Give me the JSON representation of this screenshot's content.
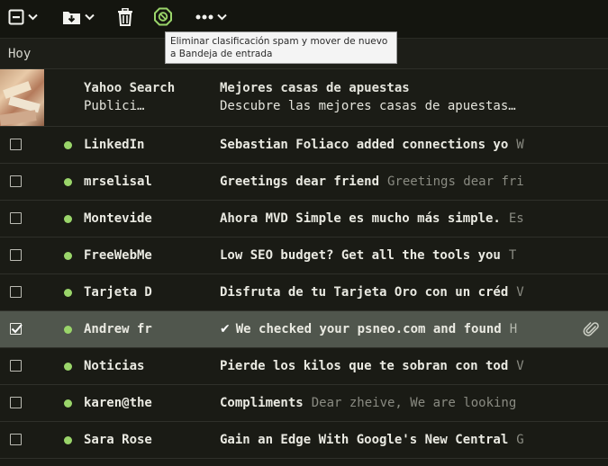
{
  "toolbar": {
    "icons": [
      "select-checkbox-icon",
      "chevron-down-icon",
      "move-to-folder-icon",
      "chevron-down-icon",
      "trash-icon",
      "not-spam-icon",
      "more-icon",
      "chevron-down-icon"
    ],
    "accent_color": "#9ad56a"
  },
  "tooltip": {
    "text": "Eliminar clasificación spam y mover de nuevo a Bandeja de entrada"
  },
  "section": {
    "title": "Hoy"
  },
  "ad": {
    "sender": "Yahoo Search",
    "sender_sub": "Publici…",
    "subject": "Mejores casas de apuestas",
    "body": "Descubre las mejores casas de apuestas…"
  },
  "messages": [
    {
      "sender": "LinkedIn",
      "subject": "Sebastian Foliaco added connections yo",
      "preview": "W",
      "checked": false,
      "attachment": false
    },
    {
      "sender": "mrselisal",
      "subject": "Greetings dear friend",
      "preview": "Greetings dear fri",
      "checked": false,
      "attachment": false
    },
    {
      "sender": "Montevide",
      "subject": "Ahora MVD Simple es mucho más simple.",
      "preview": "Es",
      "checked": false,
      "attachment": false
    },
    {
      "sender": "FreeWebMe",
      "subject": "Low SEO budget? Get all the tools you",
      "preview": "T",
      "checked": false,
      "attachment": false
    },
    {
      "sender": "Tarjeta D",
      "subject": "Disfruta de tu Tarjeta Oro con un créd",
      "preview": "V",
      "checked": false,
      "attachment": false
    },
    {
      "sender": "Andrew fr",
      "subject": "We checked your psneo.com and found",
      "preview": "H",
      "checked": true,
      "attachment": true
    },
    {
      "sender": "Noticias",
      "subject": "Pierde los kilos que te sobran con tod",
      "preview": "V",
      "checked": false,
      "attachment": false
    },
    {
      "sender": "karen@the",
      "subject": "Compliments",
      "preview": "Dear zheive, We are looking",
      "checked": false,
      "attachment": false
    },
    {
      "sender": "Sara Rose",
      "subject": "Gain an Edge With Google's New Central",
      "preview": "G",
      "checked": false,
      "attachment": false
    }
  ],
  "selected_check_glyph": "✔"
}
